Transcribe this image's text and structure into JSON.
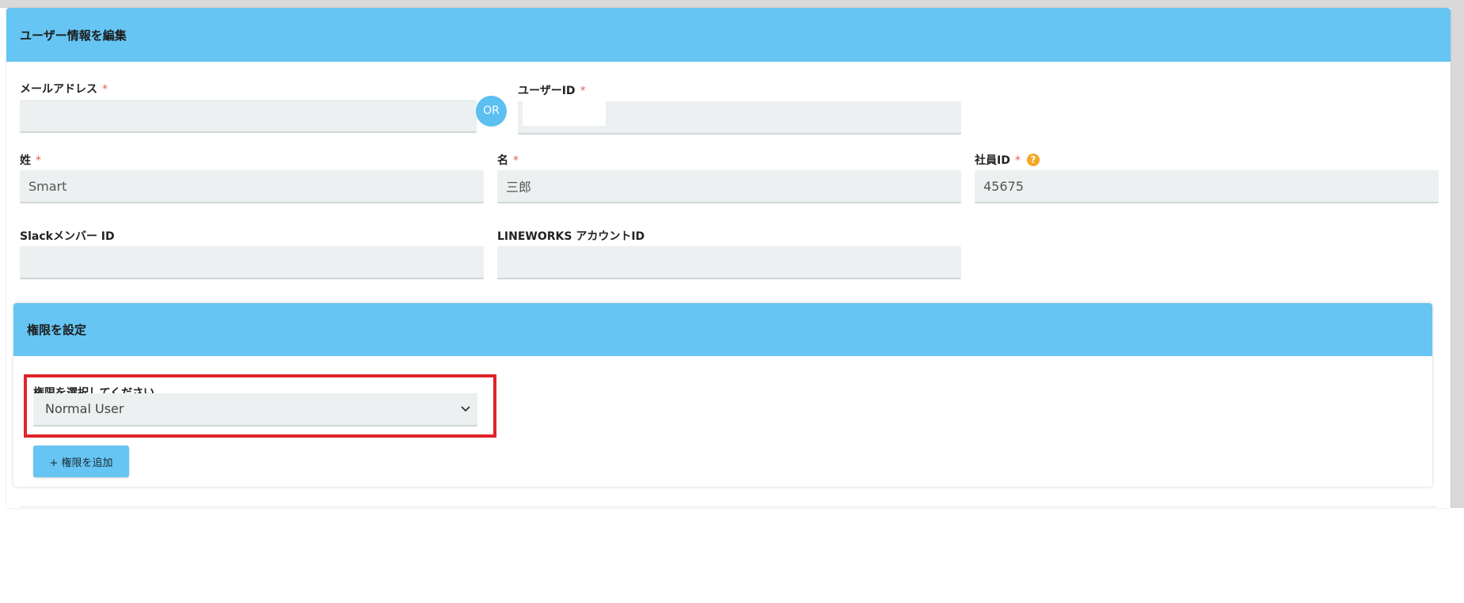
{
  "header": {
    "title": "ユーザー情報を編集"
  },
  "required_mark": "*",
  "email": {
    "label": "メールアドレス",
    "value": ""
  },
  "or_label": "OR",
  "user_id": {
    "label": "ユーザーID",
    "value": ""
  },
  "last_name": {
    "label": "姓",
    "value": "Smart"
  },
  "first_name": {
    "label": "名",
    "value": "三郎"
  },
  "employee_id": {
    "label": "社員ID",
    "value": "45675",
    "help": "?"
  },
  "slack_id": {
    "label": "Slackメンバー ID",
    "value": ""
  },
  "lineworks_id": {
    "label": "LINEWORKS アカウントID",
    "value": ""
  },
  "permissions": {
    "title": "権限を設定",
    "select_label": "権限を選択してください",
    "selected": "Normal User",
    "add_button": "+ 権限を追加"
  },
  "colors": {
    "header_bg": "#66c5f3",
    "required": "#e55a5a",
    "highlight": "#e0242a",
    "help": "#f5a623"
  }
}
